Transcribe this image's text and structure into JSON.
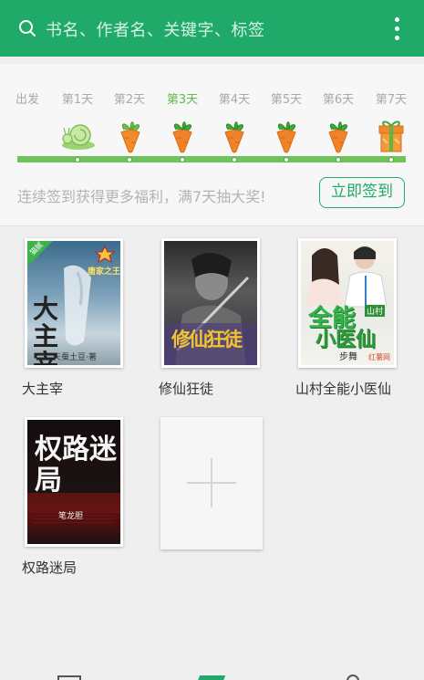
{
  "header": {
    "search_placeholder": "书名、作者名、关键字、标签",
    "bg_color": "#1faa6a"
  },
  "checkin": {
    "days": [
      "出发",
      "第1天",
      "第2天",
      "第3天",
      "第4天",
      "第5天",
      "第6天",
      "第7天"
    ],
    "active_day": "第3天",
    "tip": "连续签到获得更多福利，满7天抽大奖!",
    "button_label": "立即签到",
    "reward_icons": [
      "snail-icon",
      "carrot-icon",
      "carrot-icon",
      "carrot-icon",
      "carrot-icon",
      "carrot-icon",
      "gift-icon"
    ]
  },
  "books": [
    {
      "title": "大主宰",
      "cover_badge": "猫腻",
      "cover_series": "唐家之王",
      "cover_title": "大主宰",
      "cover_author": "天蚕土豆·著"
    },
    {
      "title": "修仙狂徒",
      "cover_title": "修仙狂徒"
    },
    {
      "title": "山村全能小医仙",
      "cover_title_main": "全能",
      "cover_title_sub": "小医仙",
      "cover_tag": "山村",
      "cover_author": "步舞",
      "cover_site": "红薯网"
    },
    {
      "title": "权路迷局",
      "cover_title": "权路迷局",
      "cover_author": "笔龙胆"
    }
  ],
  "bottom_nav": [
    "bookshelf-icon",
    "bookstore-icon",
    "profile-icon"
  ]
}
